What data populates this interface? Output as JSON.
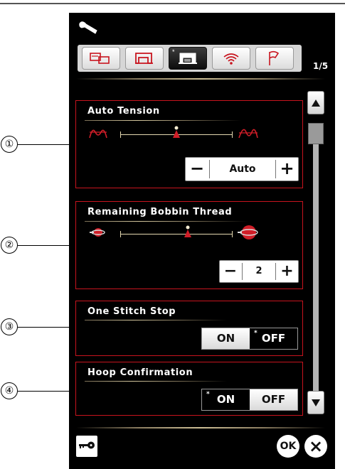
{
  "header": {
    "wrench_icon": "wrench-icon",
    "page_indicator": "1/5"
  },
  "tabs": [
    {
      "icon": "machine-sewing-settings-icon",
      "active": false
    },
    {
      "icon": "sewing-machine-icon",
      "active": false
    },
    {
      "icon": "embroidery-machine-icon",
      "active": true,
      "marker": "*"
    },
    {
      "icon": "wireless-icon",
      "active": false
    },
    {
      "icon": "flag-icon",
      "active": false
    }
  ],
  "callouts": [
    "①",
    "②",
    "③",
    "④"
  ],
  "sections": {
    "auto_tension": {
      "title": "Auto Tension",
      "stepper": {
        "minus": "−",
        "value": "Auto",
        "plus": "+"
      },
      "level": 0.5
    },
    "bobbin_thread": {
      "title": "Remaining Bobbin Thread",
      "stepper": {
        "minus": "−",
        "value": "2",
        "plus": "+"
      },
      "level": 0.5
    },
    "one_stitch_stop": {
      "title": "One Stitch Stop",
      "on_label": "ON",
      "off_label": "OFF",
      "selected": "OFF",
      "marker": "*"
    },
    "hoop_confirmation": {
      "title": "Hoop Confirmation",
      "on_label": "ON",
      "off_label": "OFF",
      "selected": "ON",
      "marker": "*"
    }
  },
  "footer": {
    "ok_label": "OK",
    "close_label": "×"
  },
  "colors": {
    "screen_bg": "#000000",
    "section_border": "#c8141e",
    "accent_red": "#d01e28",
    "rule_gold": "#cdbf96"
  }
}
